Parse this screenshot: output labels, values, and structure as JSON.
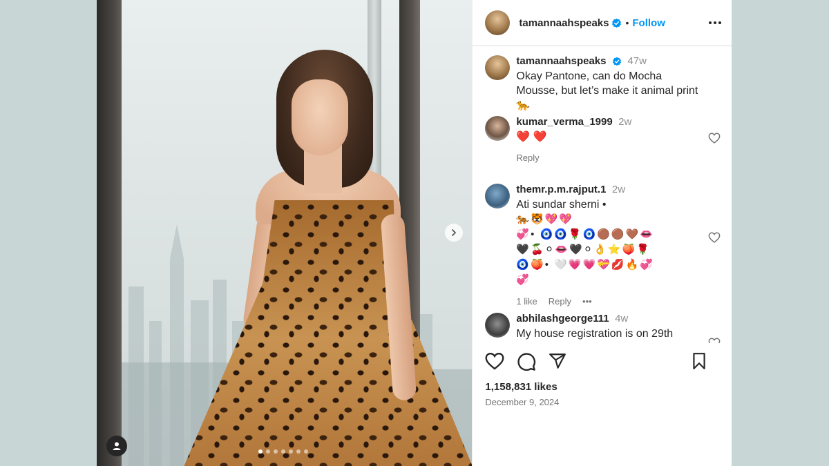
{
  "post": {
    "username": "tamannaahspeaks",
    "verified": true,
    "follow_label": "Follow",
    "separator": "•",
    "caption": {
      "username": "tamannaahspeaks",
      "time": "47w",
      "text": "Okay Pantone, can do Mocha Mousse, but let’s make it animal print 🐆"
    },
    "comments": [
      {
        "username": "kumar_verma_1999",
        "time": "2w",
        "text": "❤️ ❤️",
        "reply_label": "Reply"
      },
      {
        "username": "themr.p.m.rajput.1",
        "time": "2w",
        "text": "Ati sundar sherni •",
        "emoji_lines": [
          "🐅🐯💖💖",
          "💞•  🧿🧿🌹🧿🟤🟤🤎👄",
          "🖤🍒⚪👄🖤⚪👌⭐🍑🌹",
          "🧿🍑•  🤍💗💗💝💋🔥💞",
          "💞"
        ],
        "likes_label": "1 like",
        "reply_label": "Reply",
        "more_label": "•••"
      },
      {
        "username": "abhilashgeorge111",
        "time": "4w",
        "text": "My house registration is on 29th"
      }
    ],
    "likes": "1,158,831 likes",
    "date": "December 9, 2024",
    "carousel": {
      "slides": 7,
      "active": 0
    },
    "colors": {
      "accent": "#0095f6",
      "text": "#262626",
      "muted": "#737373",
      "verified": "#0095f6"
    }
  }
}
